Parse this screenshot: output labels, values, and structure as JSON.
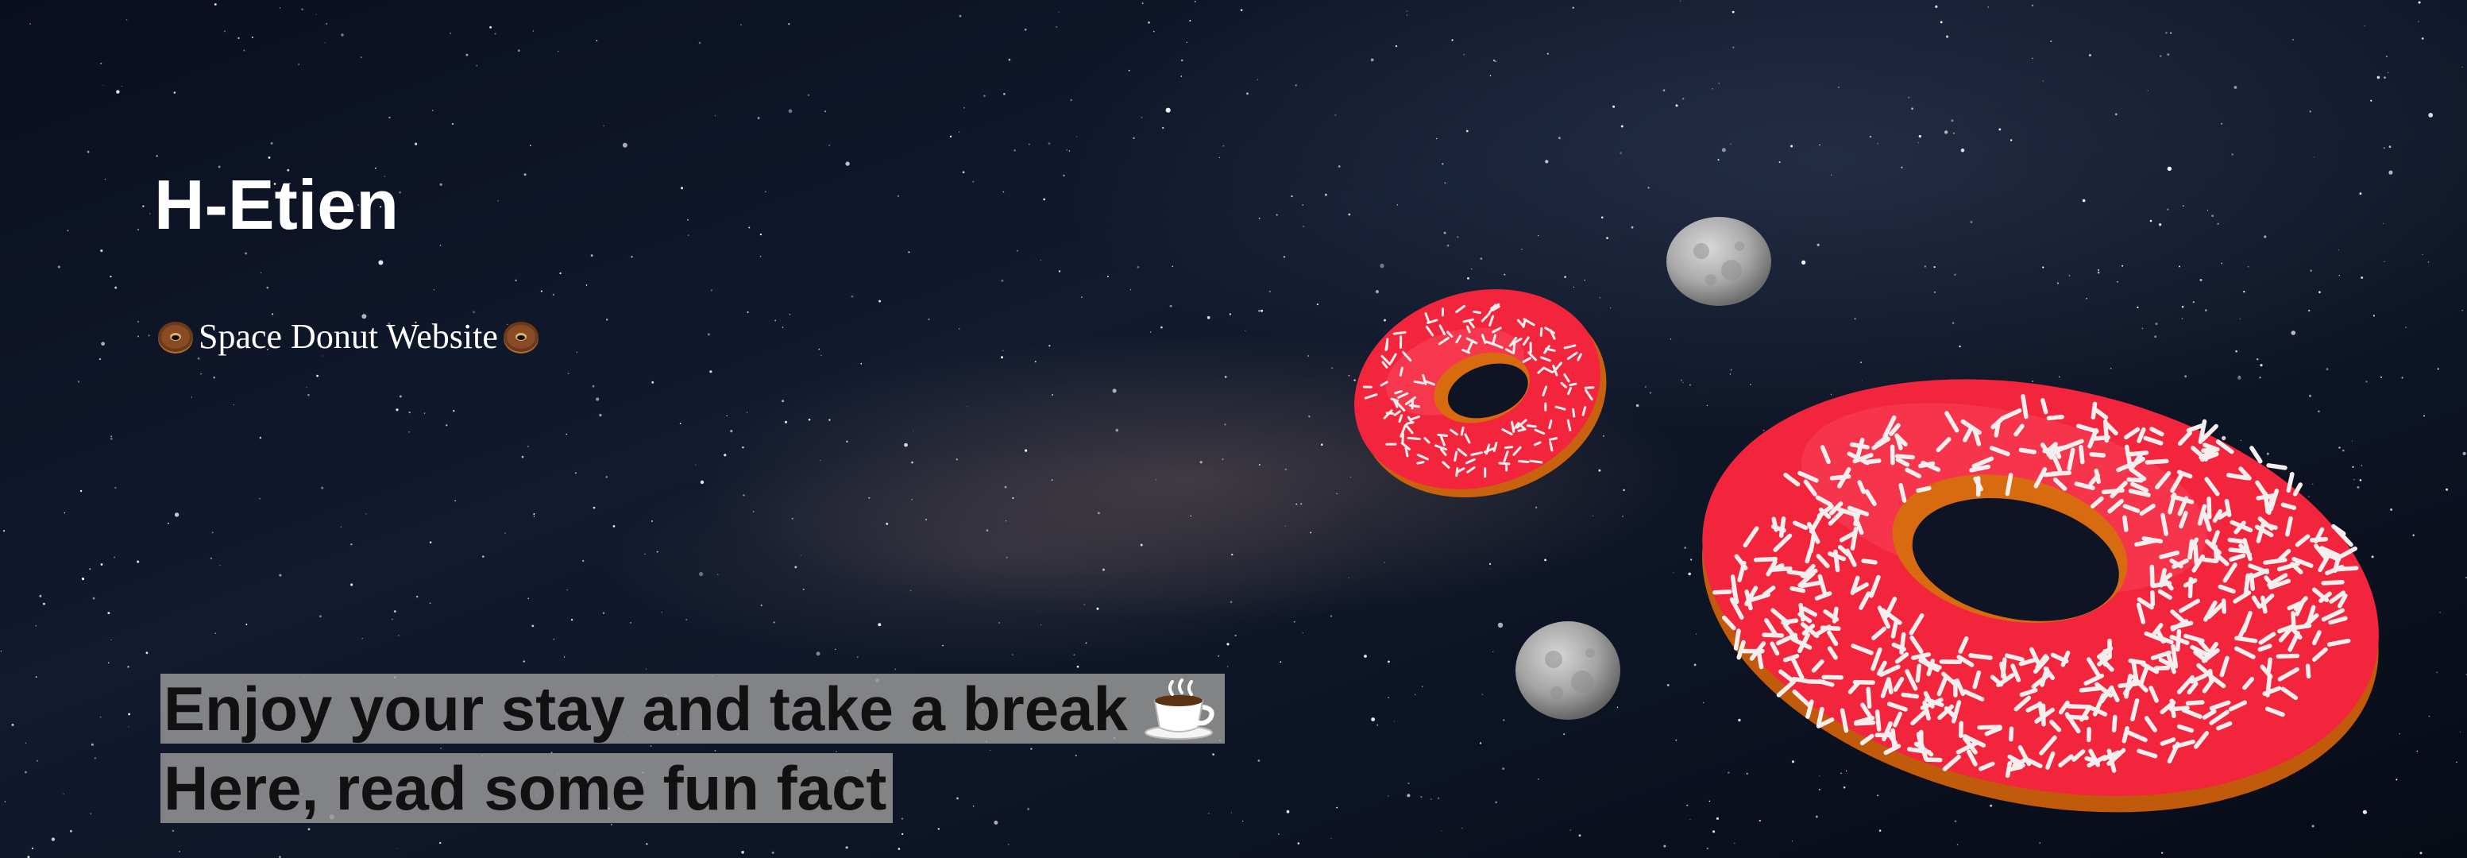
{
  "site": {
    "title": "H-Etien",
    "subtitle": "Space Donut Website",
    "subtitle_icon": "donut-icon"
  },
  "hero": {
    "line1": "Enjoy your stay and take a break",
    "line1_icon": "coffee-cup-icon",
    "line2": "Here, read some fun fact"
  },
  "colors": {
    "frosting": "#f2253d",
    "dough": "#d86a10",
    "space": "#0b0f1d",
    "tagline_bg": "#969696"
  }
}
